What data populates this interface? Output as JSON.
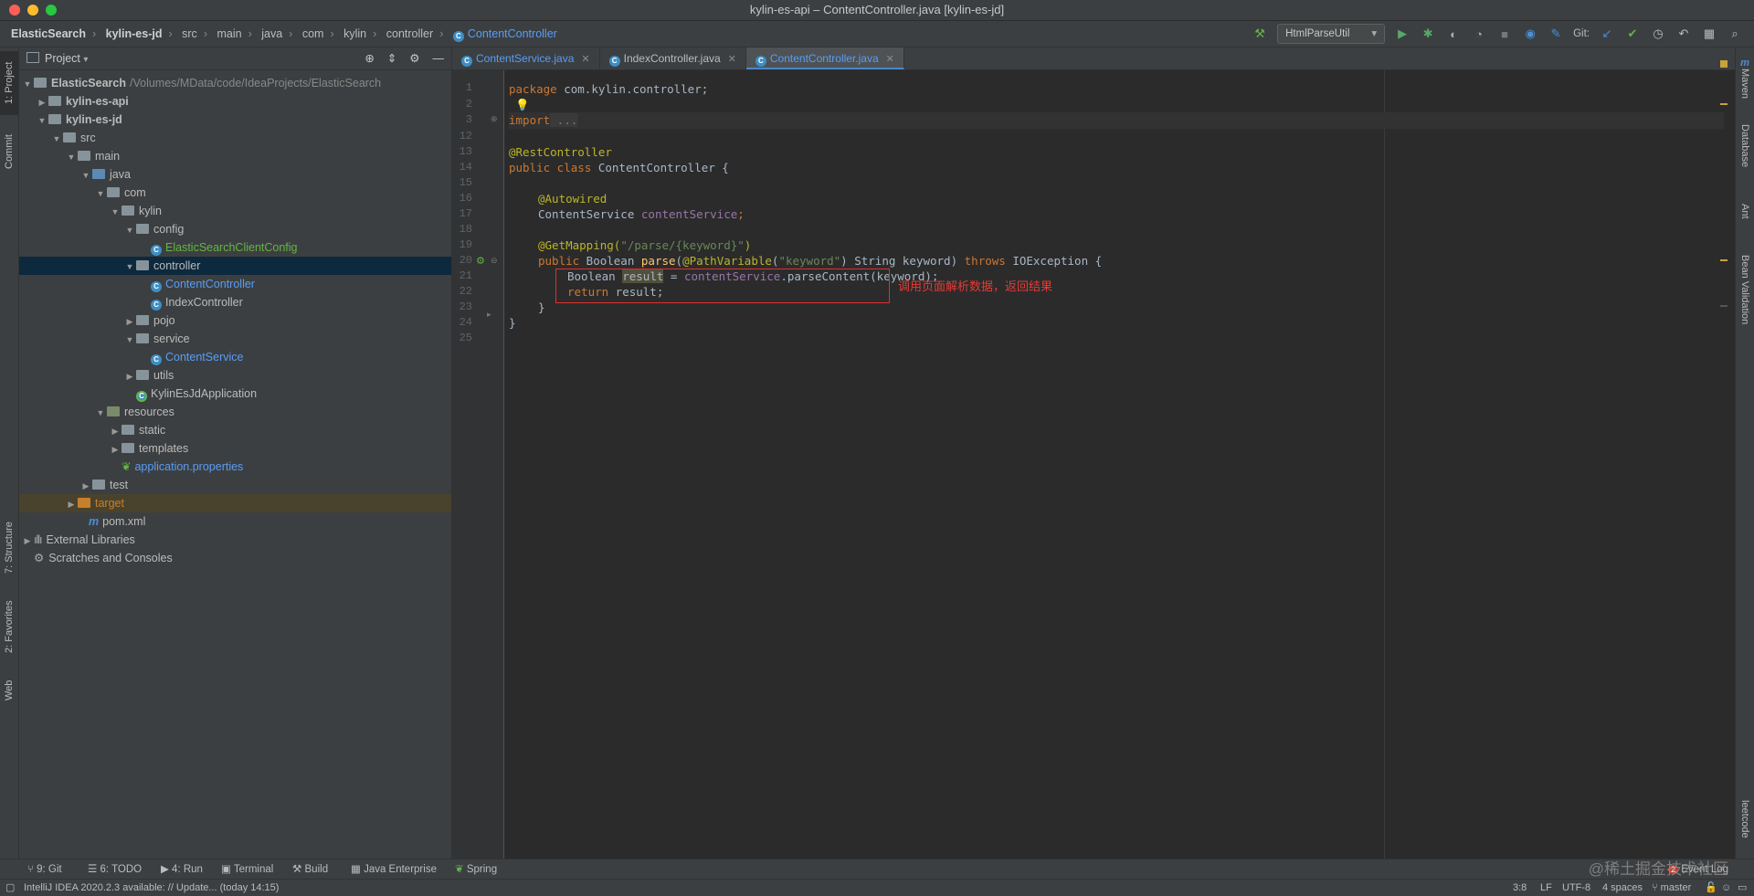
{
  "window": {
    "title": "kylin-es-api – ContentController.java [kylin-es-jd]"
  },
  "breadcrumb": [
    "ElasticSearch",
    "kylin-es-jd",
    "src",
    "main",
    "java",
    "com",
    "kylin",
    "controller",
    "ContentController"
  ],
  "toolbar": {
    "run_config": "HtmlParseUtil",
    "git_label": "Git:"
  },
  "left_strip": {
    "project": "1: Project",
    "commit": "Commit",
    "structure": "7: Structure",
    "favorites": "2: Favorites",
    "web": "Web"
  },
  "right_strip": {
    "maven": "Maven",
    "database": "Database",
    "ant": "Ant",
    "bean_validation": "Bean Validation",
    "leetcode": "leetcode"
  },
  "project_panel": {
    "title": "Project",
    "root": {
      "name": "ElasticSearch",
      "path": "/Volumes/MData/code/IdeaProjects/ElasticSearch"
    },
    "items": [
      {
        "label": "kylin-es-api"
      },
      {
        "label": "kylin-es-jd"
      },
      {
        "label": "src"
      },
      {
        "label": "main"
      },
      {
        "label": "java"
      },
      {
        "label": "com"
      },
      {
        "label": "kylin"
      },
      {
        "label": "config"
      },
      {
        "label": "ElasticSearchClientConfig"
      },
      {
        "label": "controller"
      },
      {
        "label": "ContentController"
      },
      {
        "label": "IndexController"
      },
      {
        "label": "pojo"
      },
      {
        "label": "service"
      },
      {
        "label": "ContentService"
      },
      {
        "label": "utils"
      },
      {
        "label": "KylinEsJdApplication"
      },
      {
        "label": "resources"
      },
      {
        "label": "static"
      },
      {
        "label": "templates"
      },
      {
        "label": "application.properties"
      },
      {
        "label": "test"
      },
      {
        "label": "target"
      },
      {
        "label": "pom.xml"
      },
      {
        "label": "External Libraries"
      },
      {
        "label": "Scratches and Consoles"
      }
    ]
  },
  "editor": {
    "tabs": [
      {
        "label": "ContentService.java"
      },
      {
        "label": "IndexController.java"
      },
      {
        "label": "ContentController.java"
      }
    ],
    "line_numbers": [
      "1",
      "2",
      "3",
      "12",
      "13",
      "14",
      "15",
      "16",
      "17",
      "18",
      "19",
      "20",
      "21",
      "22",
      "23",
      "24",
      "25"
    ],
    "code": {
      "l1_kw": "package",
      "l1_rest": " com.kylin.controller;",
      "l3_kw": "import",
      "l3_rest": " ...",
      "l13_ann": "@RestController",
      "l14_kw": "public class",
      "l14_rest": " ContentController {",
      "l16_ann": "@Autowired",
      "l17_type": "ContentService ",
      "l17_field": "contentService",
      "l17_end": ";",
      "l19_ann": "@GetMapping(",
      "l19_str": "\"/parse/{keyword}\"",
      "l19_end": ")",
      "l20_kw": "public",
      "l20_a": " Boolean ",
      "l20_fn": "parse",
      "l20_b": "(",
      "l20_ann": "@PathVariable",
      "l20_c": "(",
      "l20_str": "\"keyword\"",
      "l20_d": ") String keyword) ",
      "l20_kw2": "throws",
      "l20_e": " IOException {",
      "l21_a": "Boolean ",
      "l21_var": "result",
      "l21_b": " = ",
      "l21_fld": "contentService",
      "l21_c": ".parseContent(keyword);",
      "l22_kw": "return",
      "l22_rest": " result;",
      "l23": "}",
      "l24": "}"
    },
    "annotation_note": "调用页面解析数据，返回结果"
  },
  "bottom_tools": [
    {
      "label": "9: Git"
    },
    {
      "label": "6: TODO"
    },
    {
      "label": "4: Run"
    },
    {
      "label": "Terminal"
    },
    {
      "label": "Build"
    },
    {
      "label": "Java Enterprise"
    },
    {
      "label": "Spring"
    }
  ],
  "status": {
    "message": "IntelliJ IDEA 2020.2.3 available: // Update... (today 14:15)",
    "position": "3:8",
    "line_sep": "LF",
    "encoding": "UTF-8",
    "indent": "4 spaces",
    "branch": "master",
    "event_log": "Event Log",
    "event_count": "2"
  },
  "watermark": "@稀土掘金技术社区"
}
